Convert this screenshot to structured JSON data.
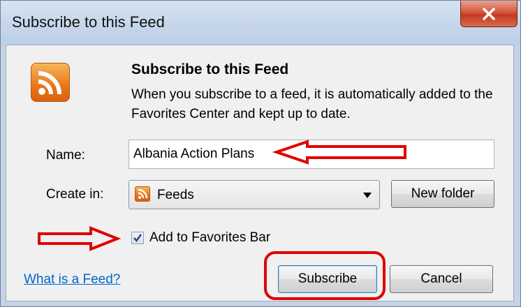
{
  "window": {
    "title": "Subscribe to this Feed",
    "close_symbol": "X"
  },
  "dialog": {
    "icon": "rss-feed-icon",
    "heading": "Subscribe to this Feed",
    "description": "When you subscribe to a feed, it is automatically added to the Favorites Center and kept up to date."
  },
  "form": {
    "name_label": "Name:",
    "name_value": "Albania Action Plans",
    "create_in_label": "Create in:",
    "create_in_value": "Feeds",
    "create_in_icon": "rss-feed-icon",
    "new_folder_label": "New folder",
    "add_to_favorites_label": "Add to Favorites Bar",
    "add_to_favorites_checked": true
  },
  "footer": {
    "help_link": "What is a Feed?",
    "subscribe_label": "Subscribe",
    "cancel_label": "Cancel"
  },
  "colors": {
    "annotation": "#e00000",
    "link": "#0066cc",
    "rss_orange": "#e8761a",
    "close_red": "#c43a1e"
  }
}
